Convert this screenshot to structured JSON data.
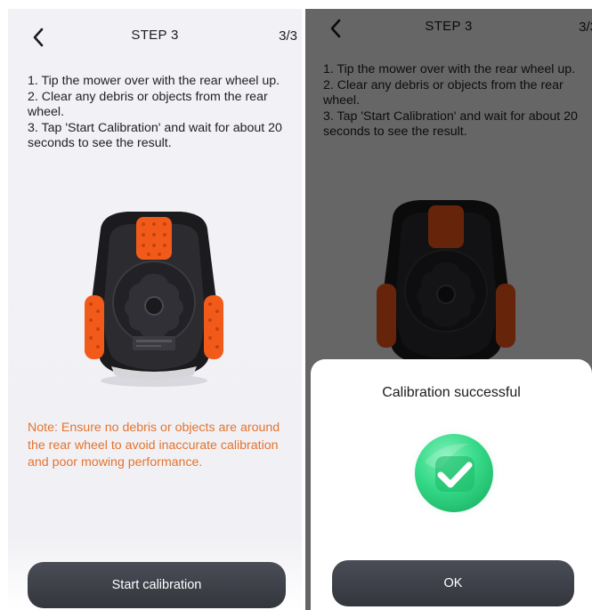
{
  "step_screen": {
    "title": "STEP 3",
    "page_indicator": "3/3",
    "instructions": [
      "1. Tip the mower over with the rear wheel up.",
      "2. Clear any debris or objects from the rear wheel.",
      "3. Tap 'Start Calibration' and wait for about 20 seconds to see the result."
    ],
    "note": "Note: Ensure no debris or objects are around the rear wheel to avoid inaccurate calibration and poor mowing performance.",
    "button_label": "Start calibration"
  },
  "result_dialog": {
    "title": "Calibration successful",
    "button_label": "OK"
  },
  "colors": {
    "note": "#e5732e",
    "button": "#3a3d44",
    "success": "#2fd67f"
  },
  "icons": {
    "back": "chevron-left-icon",
    "success": "check-circle-icon",
    "product": "mower-underside-image"
  }
}
